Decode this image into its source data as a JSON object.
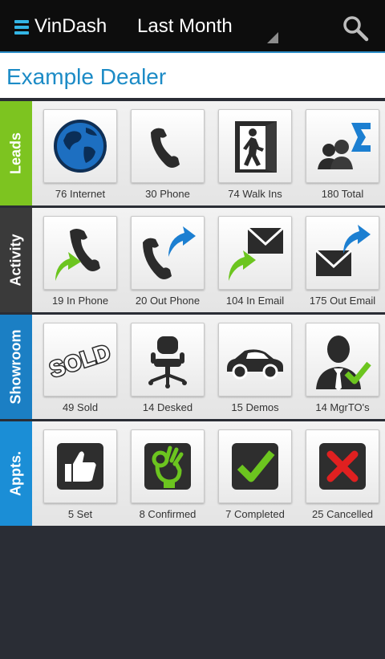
{
  "header": {
    "app_name": "VinDash",
    "period": "Last Month",
    "accent_color": "#33b5e5"
  },
  "dealer": {
    "name": "Example Dealer"
  },
  "sections": [
    {
      "title": "Leads",
      "color": "#7dc420",
      "items": [
        {
          "label": "76 Internet",
          "icon": "globe-icon"
        },
        {
          "label": "30 Phone",
          "icon": "phone-icon"
        },
        {
          "label": "74 Walk Ins",
          "icon": "walk-in-icon"
        },
        {
          "label": "180 Total",
          "icon": "total-icon"
        }
      ]
    },
    {
      "title": "Activity",
      "color": "#3a3a3a",
      "items": [
        {
          "label": "19 In Phone",
          "icon": "in-phone-icon"
        },
        {
          "label": "20 Out Phone",
          "icon": "out-phone-icon"
        },
        {
          "label": "104 In Email",
          "icon": "in-email-icon"
        },
        {
          "label": "175 Out Email",
          "icon": "out-email-icon"
        }
      ]
    },
    {
      "title": "Showroom",
      "color": "#1b7fc4",
      "items": [
        {
          "label": "49 Sold",
          "icon": "sold-icon"
        },
        {
          "label": "14 Desked",
          "icon": "desk-chair-icon"
        },
        {
          "label": "15 Demos",
          "icon": "car-icon"
        },
        {
          "label": "14 MgrTO's",
          "icon": "manager-icon"
        }
      ]
    },
    {
      "title": "Appts.",
      "color": "#1b8ed6",
      "items": [
        {
          "label": "5 Set",
          "icon": "thumbs-up-icon"
        },
        {
          "label": "8 Confirmed",
          "icon": "ok-hand-icon"
        },
        {
          "label": "7 Completed",
          "icon": "check-icon"
        },
        {
          "label": "25 Cancelled",
          "icon": "cross-icon"
        }
      ]
    }
  ],
  "sold_stamp_text": "SOLD"
}
